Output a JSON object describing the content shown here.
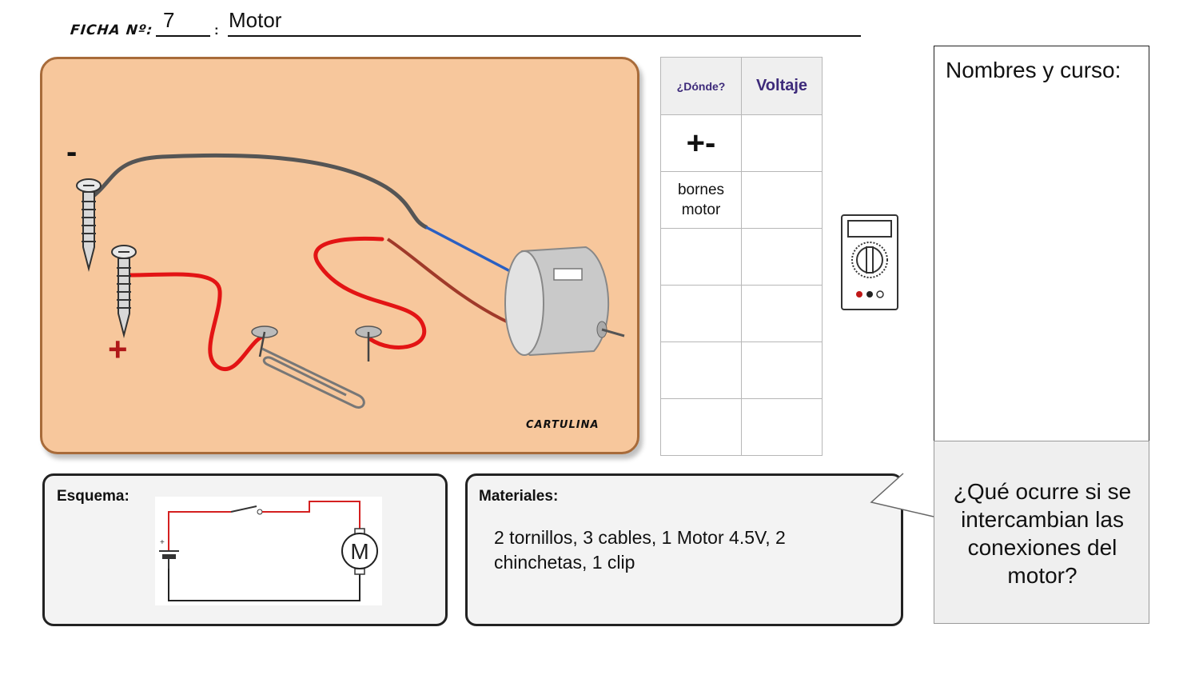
{
  "header": {
    "ficha_label": "FICHA Nº:",
    "ficha_number": "7",
    "separator": ":",
    "title": "Motor"
  },
  "board": {
    "cartulina_label": "CARTULINA",
    "minus": "-",
    "plus": "+",
    "motor_color": "#c9c9c9",
    "wire_red": "#e31414",
    "wire_gray": "#555555"
  },
  "table": {
    "headers": [
      "¿Dónde?",
      "Voltaje"
    ],
    "rows": [
      {
        "where": "+-",
        "voltage": ""
      },
      {
        "where": "bornes motor",
        "voltage": ""
      },
      {
        "where": "",
        "voltage": ""
      },
      {
        "where": "",
        "voltage": ""
      },
      {
        "where": "",
        "voltage": ""
      },
      {
        "where": "",
        "voltage": ""
      }
    ]
  },
  "multimeter": {
    "icon": "multimeter-icon"
  },
  "names": {
    "label": "Nombres y curso:"
  },
  "question": {
    "text": "¿Qué ocurre si se intercambian las conexiones del motor?"
  },
  "esquema": {
    "label": "Esquema:",
    "motor_symbol": "M",
    "plus_symbol": "+"
  },
  "materiales": {
    "label": "Materiales:",
    "text": "2 tornillos, 3 cables, 1 Motor 4.5V, 2 chinchetas, 1 clip"
  }
}
